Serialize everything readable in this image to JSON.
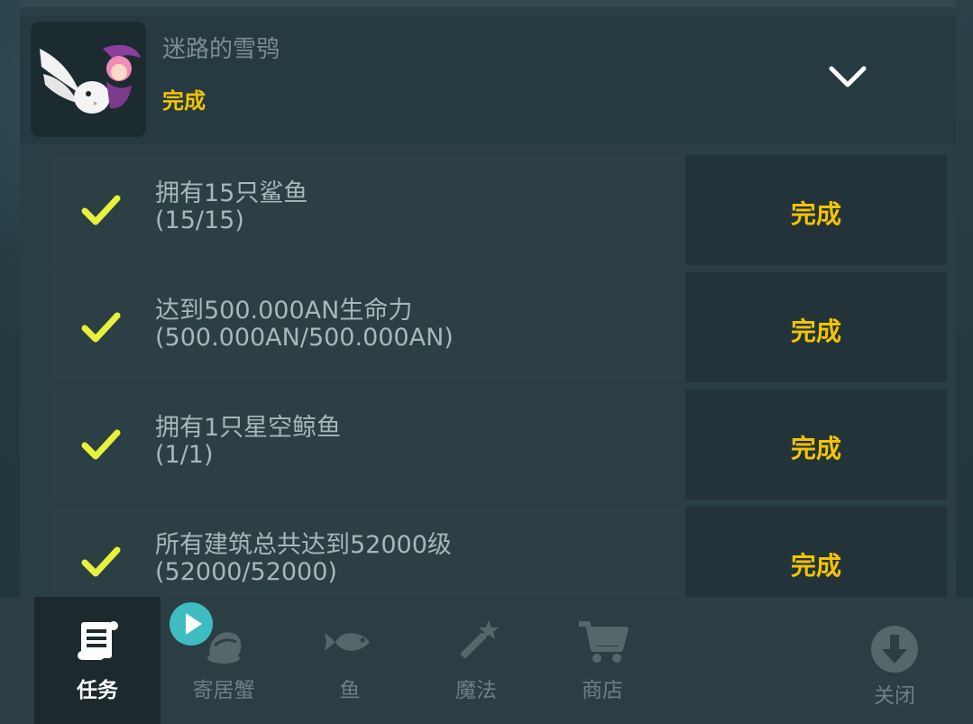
{
  "header": {
    "title": "迷路的雪鸮",
    "status": "完成"
  },
  "tasks": [
    {
      "name": "拥有15只鲨鱼",
      "progress": "(15/15)",
      "status": "完成"
    },
    {
      "name": "达到500.000AN生命力",
      "progress": "(500.000AN/500.000AN)",
      "status": "完成"
    },
    {
      "name": "拥有1只星空鲸鱼",
      "progress": "(1/1)",
      "status": "完成"
    },
    {
      "name": "所有建筑总共达到52000级",
      "progress": "(52000/52000)",
      "status": "完成"
    }
  ],
  "nav": {
    "tabs": [
      {
        "label": "任务",
        "icon": "scroll-icon",
        "active": true
      },
      {
        "label": "寄居蟹",
        "icon": "hermit-crab-icon",
        "active": false
      },
      {
        "label": "鱼",
        "icon": "fish-icon",
        "active": false
      },
      {
        "label": "魔法",
        "icon": "magic-wand-icon",
        "active": false
      },
      {
        "label": "商店",
        "icon": "cart-icon",
        "active": false
      },
      {
        "label": "关闭",
        "icon": "download-arrow-icon",
        "active": false
      }
    ],
    "video_badge_icon": "play-icon"
  },
  "colors": {
    "accent_gold": "#f5c400",
    "check_yellow": "#e8f23a",
    "badge_teal": "#3fbcc0"
  }
}
